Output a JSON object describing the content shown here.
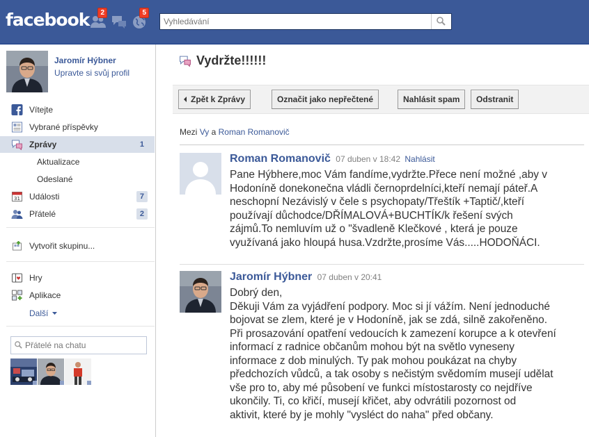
{
  "topbar": {
    "logo": "facebook",
    "friend_requests_count": "2",
    "notifications_count": "5",
    "search_placeholder": "Vyhledávání"
  },
  "profile": {
    "name": "Jaromír Hýbner",
    "edit_link": "Upravte si svůj profil"
  },
  "nav": {
    "welcome": "Vítejte",
    "news_feed": "Vybrané příspěvky",
    "messages": "Zprávy",
    "messages_count": "1",
    "updates": "Aktualizace",
    "sent": "Odeslané",
    "events": "Události",
    "events_count": "7",
    "friends": "Přátelé",
    "friends_count": "2",
    "create_group": "Vytvořit skupinu...",
    "games": "Hry",
    "apps": "Aplikace",
    "more": "Další"
  },
  "chat": {
    "search_placeholder": "Přátelé na chatu"
  },
  "thread": {
    "title": "Vydržte!!!!!!",
    "toolbar": {
      "back": "Zpět k Zprávy",
      "mark_unread": "Označit jako nepřečtené",
      "report_spam": "Nahlásit spam",
      "delete": "Odstranit"
    },
    "between_prefix": "Mezi",
    "between_you": "Vy",
    "between_and": "a",
    "between_other": "Roman Romanovič",
    "messages": [
      {
        "author": "Roman Romanovič",
        "time": "07 duben v 18:42",
        "report": "Nahlásit",
        "body": "Pane Hýbhere,moc Vám fandíme,vydržte.Přece není možné ,aby v\nHodoníně donekonečna vládli černoprdelníci,kteří nemají páteř.A\nneschopní Nezávislý v čele s psychopaty/Třeštík +Taptič/,kteří\npoužívají důchodce/DŘÍMALOVÁ+BUCHTÍK/k řešení svých\nzájmů.To nemluvím už o \"švadleně Klečkové , která je pouze\nvyužívaná jako hloupá husa.Vzdržte,prosíme Vás.....HODOŇÁCI."
      },
      {
        "author": "Jaromír Hýbner",
        "time": "07 duben v 20:41",
        "body": "Dobrý den,\nDěkuji Vám za vyjádření podpory. Moc si jí vážím. Není jednoduché\nbojovat se zlem, které je v Hodoníně, jak se zdá, silně zakořeněno.\nPři prosazování opatření vedoucích k zamezení korupce a k otevření\ninformací z radnice občanům mohou být na světlo vyneseny\ninformace z dob minulých. Ty pak mohou poukázat na chyby\npředchozích vůdců, a tak osoby s nečistým svědomím musejí udělat\nvše pro to, aby mé působení ve funkci místostarosty co nejdříve\nukončily. Ti, co křičí, musejí křičet, aby odvrátili pozornost od\naktivit, které by je mohly \"vysléct do naha\" před občany."
      }
    ]
  },
  "colors": {
    "brand_blue": "#3b5998",
    "selected_nav": "#d8dfea",
    "badge_red": "#f03d25"
  }
}
